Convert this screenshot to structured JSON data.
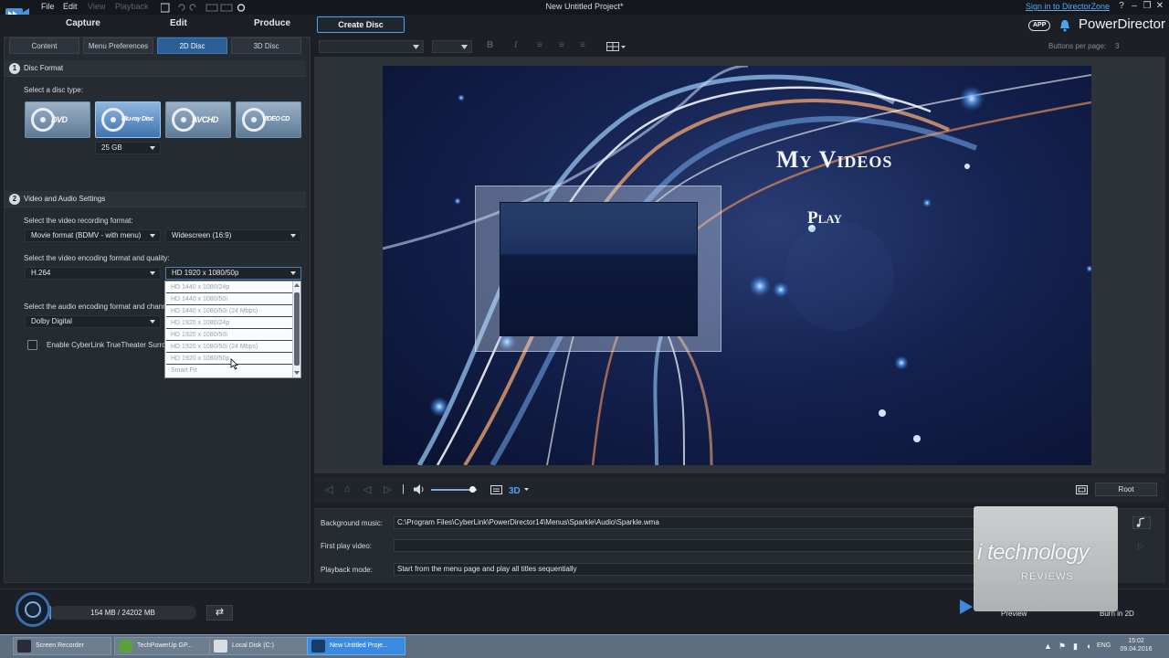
{
  "app": {
    "project_title": "New Untitled Project*",
    "menu": [
      "File",
      "Edit",
      "View",
      "Playback"
    ],
    "signin": "Sign in to DirectorZone",
    "brand_badge": "APP",
    "brand_name": "PowerDirector",
    "help": "?"
  },
  "main_tabs": [
    "Capture",
    "Edit",
    "Produce",
    "Create Disc"
  ],
  "sub_tabs": [
    "Content",
    "Menu Preferences",
    "2D Disc",
    "3D Disc"
  ],
  "disc_format": {
    "number": "1",
    "title": "Disc Format",
    "prompt": "Select a disc type:",
    "types": [
      "DVD",
      "Blu-ray Disc",
      "AVCHD",
      "VIDEO CD"
    ],
    "size": "25 GB"
  },
  "video_audio": {
    "number": "2",
    "title": "Video and Audio Settings",
    "recording_label": "Select the video recording format:",
    "recording_format": "Movie format (BDMV - with menu)",
    "aspect": "Widescreen (16:9)",
    "encoding_label": "Select the video encoding format and quality:",
    "codec": "H.264",
    "quality": "HD 1920 x 1080/50p",
    "audio_label": "Select the audio encoding format and chann",
    "audio_format": "Dolby Digital",
    "truetheater": "Enable CyberLink TrueTheater Surrou",
    "truetheater_checked": false
  },
  "quality_options": [
    "HD 1440 x 1080/24p",
    "HD 1440 x 1080/50i",
    "HD 1440 x 1080/50i (24 Mbps)",
    "HD 1920 x 1080/24p",
    "HD 1920 x 1080/50i",
    "HD 1920 x 1080/50i (24 Mbps)",
    "HD 1920 x 1080/50p",
    "Smart Fit"
  ],
  "toolbar": {
    "buttons_per_page_label": "Buttons per page:",
    "buttons_per_page_value": "3"
  },
  "menu_preview": {
    "title": "My Videos",
    "play": "Play"
  },
  "playback": {
    "root_label": "Root",
    "volume": 0.9
  },
  "settings": {
    "background_music_label": "Background music:",
    "background_music_value": "C:\\Program Files\\CyberLink\\PowerDirector14\\Menus\\Sparkle\\Audio\\Sparkle.wma",
    "first_play_label": "First play video:",
    "first_play_value": "",
    "playback_mode_label": "Playback mode:",
    "playback_mode_value": "Start from the menu page and play all titles sequentially"
  },
  "watermark": {
    "title": "i technology",
    "subtitle": "REVIEWS"
  },
  "bottom": {
    "usage": "154 MB / 24202 MB",
    "usage_fraction": 0.0064,
    "preview_label": "Preview",
    "burn_label": "Burn in 2D"
  },
  "taskbar": {
    "items": [
      "Screen Recorder",
      "TechPowerUp GP...",
      "Local Disk (C:)",
      "New Untitled Proje..."
    ],
    "language": "ENG",
    "time": "15:02",
    "date": "09.04.2016"
  },
  "colors": {
    "accent": "#3b7cc0",
    "link": "#5aa7ef",
    "taskbar": "#5d6e80"
  }
}
